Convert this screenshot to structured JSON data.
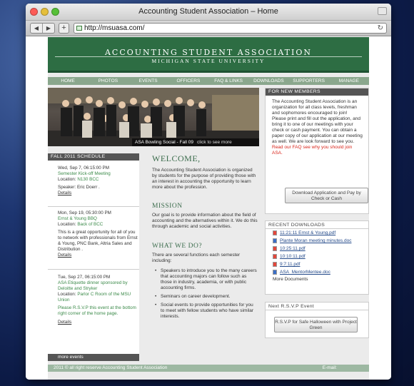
{
  "window": {
    "title": "Accounting Student Association – Home",
    "url": "http://msuasa.com/"
  },
  "banner": {
    "title": "ACCOUNTING STUDENT ASSOCIATION",
    "subtitle": "MICHIGAN STATE UNIVERSITY"
  },
  "nav": [
    "HOME",
    "PHOTOS",
    "EVENTS",
    "OFFICERS",
    "FAQ & LINKS",
    "DOWNLOADS",
    "SUPPORTERS",
    "MANAGE"
  ],
  "hero": {
    "caption": "ASA Bowling Social - Fall 09",
    "click": "click to see more"
  },
  "schedule": {
    "heading": "FALL 2011 SCHEDULE",
    "events": [
      {
        "date": "Wed, Sep 7, 06:15:00 PM",
        "title": "Semester Kick-off Meeting",
        "loc_label": "Location:",
        "location": "N130 BCC",
        "desc": "Speaker: Eric Doerr .",
        "details": "Details"
      },
      {
        "date": "Mon, Sep 19, 05:30:00 PM",
        "title": "Ernst & Young BBQ",
        "loc_label": "Location:",
        "location": "Back of BCC",
        "desc": "This is a great opportunity for all of you to network with professionals from Ernst & Young, PNC Bank, Altria Sales and Distribution .",
        "details": "Details"
      },
      {
        "date": "Tue, Sep 27, 06:15:00 PM",
        "title": "ASA Etiquette dinner sponsored by Deloitte and Stryker",
        "loc_label": "Location:",
        "location": "Parlor C Room of the MSU Union",
        "desc": "Please R.S.V.P this event at the bottom right corner of the home page.",
        "details": "Details"
      }
    ],
    "more": "more events"
  },
  "main": {
    "welcome_h": "WELCOME,",
    "welcome_p": "The Accounting Student Association is organized by students for the purpose of providing those with an interest in accounting the opportunity to learn more about the profession.",
    "mission_h": "MISSION",
    "mission_p": "Our goal is to provide information about the field of accounting and the alternatives within it. We do this through academic and social activities.",
    "whatwedo_h": "WHAT WE DO?",
    "whatwedo_p": "There are several functions each semester including:",
    "bullets": [
      "Speakers to introduce you to the many careers that accounting majors can follow such as those in industry, academia, or with public accounting firms.",
      "Seminars on career development.",
      "Social events to provide opportunities for you to meet with fellow students who have similar interests."
    ]
  },
  "members": {
    "heading": "FOR NEW MEMBERS",
    "p1": "The Accounting Student Association is an organization for all class levels, freshman and sophomores encouraged to join!",
    "p2": "Please print and fill out the application, and bring it to one of our meetings with your check or cash payment. You can obtain a paper copy of our application at our meeting as well. We are look forward to see you.",
    "red": "Read our FAQ see why you should join ASA.",
    "button": "Download Application and Pay by Check or Cash"
  },
  "downloads": {
    "heading": "RECENT DOWNLOADS",
    "files": [
      {
        "icon": "pdf-icon",
        "name": "11:21:11 Ernst & Young.pdf"
      },
      {
        "icon": "doc-icon",
        "name": "Plante Moran meeting minutes.doc"
      },
      {
        "icon": "pdf-icon",
        "name": "10:25:11.pdf"
      },
      {
        "icon": "pdf-icon",
        "name": "10:10:11.pdf"
      },
      {
        "icon": "pdf-icon",
        "name": "9:7:11.pdf"
      },
      {
        "icon": "doc-icon",
        "name": "ASA_MentorMentee.doc"
      }
    ],
    "more": "More Documents"
  },
  "rsvp": {
    "heading": "Next  R.S.V.P Event",
    "button": "R.S.V.P for Safe Halloween with Project Green"
  },
  "footer": {
    "copyright": "2011 © all right reserve Accounting Student Association",
    "email": "E-mail:"
  }
}
